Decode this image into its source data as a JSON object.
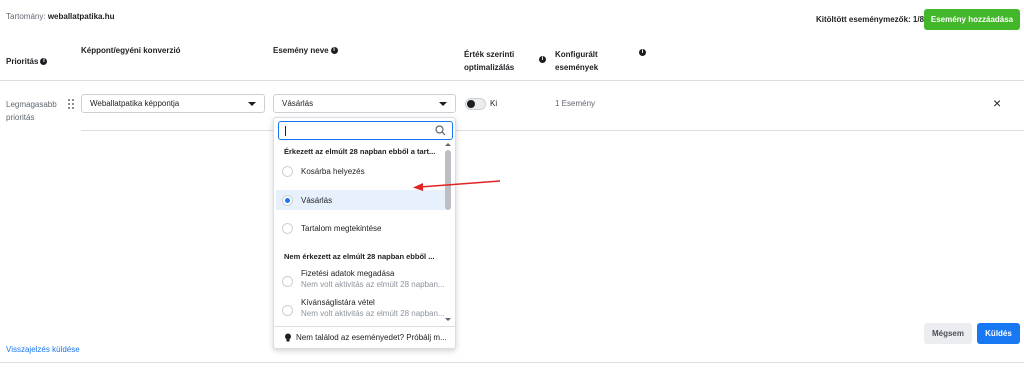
{
  "header": {
    "domain_label": "Tartomány:",
    "domain_value": "weballatpatika.hu",
    "filled_fields": "Kitöltött eseménymezők: 1/8",
    "add_event_button": "Esemény hozzáadása"
  },
  "columns": {
    "priority": "Prioritás",
    "pixel": "Képpont/egyéni konverzió",
    "event_name": "Esemény neve",
    "value_opt_line1": "Érték szerinti",
    "value_opt_line2": "optimalizálás",
    "configured_line1": "Konfigurált",
    "configured_line2": "események"
  },
  "row": {
    "priority_line1": "Legmagasabb",
    "priority_line2": "prioritás",
    "pixel_value": "Weballatpatika képpontja",
    "event_value": "Vásárlás",
    "toggle_label": "Ki",
    "toggle_on": false,
    "event_count": "1 Esemény",
    "remove_icon": "×"
  },
  "dropdown": {
    "search_value": "",
    "group1": "Érkezett az elmúlt 28 napban ebből a tart...",
    "options1": [
      {
        "label": "Kosárba helyezés",
        "selected": false
      },
      {
        "label": "Vásárlás",
        "selected": true
      },
      {
        "label": "Tartalom megtekintése",
        "selected": false
      }
    ],
    "group2": "Nem érkezett az elmúlt 28 napban ebből ...",
    "options2": [
      {
        "label": "Fizetési adatok megadása",
        "sub": "Nem volt aktivitás az elmúlt 28 napban..."
      },
      {
        "label": "Kívánságlistára vétel",
        "sub": "Nem volt aktivitás az elmúlt 28 napban..."
      }
    ],
    "footer_icon": "lightbulb-icon",
    "footer": "Nem találod az eseményedet? Próbálj m..."
  },
  "footer": {
    "feedback_link": "Visszajelzés küldése",
    "cancel_button": "Mégsem",
    "send_button": "Küldés"
  },
  "colors": {
    "green": "#42b72a",
    "blue": "#1877f2",
    "annotation_arrow": "#e02424"
  }
}
